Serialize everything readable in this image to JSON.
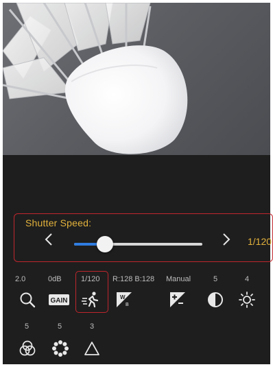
{
  "shutter": {
    "label": "Shutter Speed:",
    "value": "1/120",
    "slider_level": 0.24,
    "prev_icon": "chevron-left-icon",
    "next_icon": "chevron-right-icon"
  },
  "settings_row1": [
    {
      "value": "2.0",
      "icon": "zoom-icon"
    },
    {
      "value": "0dB",
      "icon": "gain-icon",
      "icon_text": "GAIN"
    },
    {
      "value": "1/120",
      "icon": "shutter-speed-icon"
    },
    {
      "value": "R:128 B:128",
      "icon": "white-balance-icon"
    },
    {
      "value": "Manual",
      "icon": "exposure-icon"
    },
    {
      "value": "5",
      "icon": "contrast-icon"
    },
    {
      "value": "4",
      "icon": "brightness-icon"
    }
  ],
  "settings_row2": [
    {
      "value": "5",
      "icon": "saturation-icon"
    },
    {
      "value": "5",
      "icon": "sharpness-icon"
    },
    {
      "value": "3",
      "icon": "gamma-icon"
    }
  ],
  "colors": {
    "accent": "#e3b23c",
    "highlight_border": "#c0262d",
    "slider_fill": "#2f7de1",
    "panel_bg": "#1e1e1e"
  }
}
